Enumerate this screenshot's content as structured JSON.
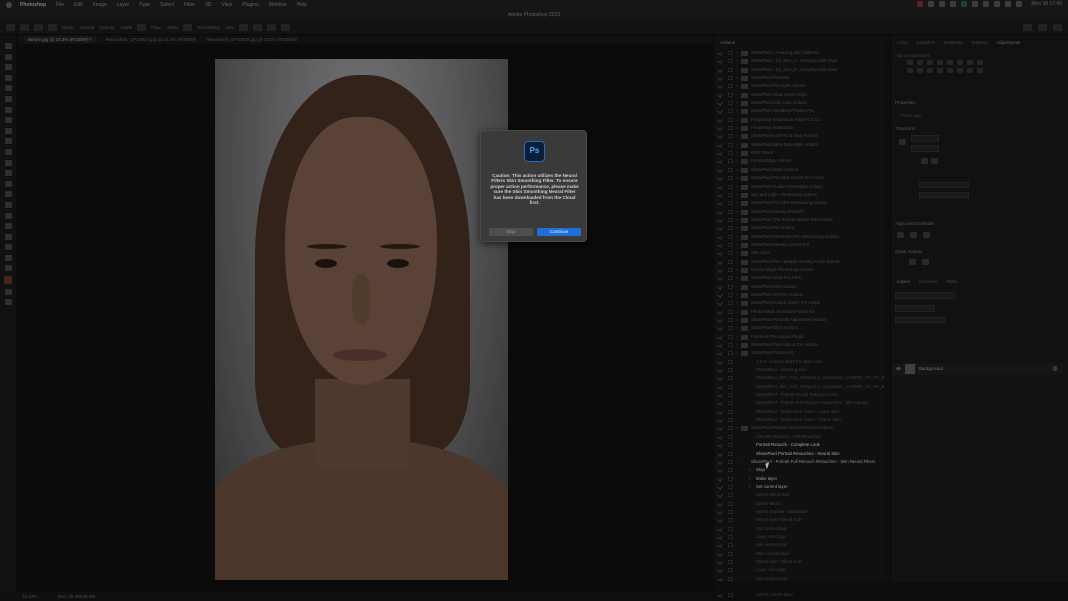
{
  "menubar": {
    "items": [
      "Photoshop",
      "File",
      "Edit",
      "Image",
      "Layer",
      "Type",
      "Select",
      "Filter",
      "3D",
      "View",
      "Plugins",
      "Window",
      "Help"
    ],
    "clock": "Mon 18 17:40"
  },
  "titlebar": {
    "title": "Adobe Photoshop 2023"
  },
  "optionsbar": {
    "labels": [
      "Mode:",
      "Normal",
      "Opacity:",
      "100%",
      "Flow:",
      "100%",
      "Smoothing:",
      "10%"
    ]
  },
  "tabs": [
    "Before.jpg @ 33.3% (RGB/8#) *",
    "Retouched_GP10837.jpg @ 33.3% (RGB/8#)",
    "Retouched_GP10838.jpg @ 33.3% (RGB/8#)"
  ],
  "dialog": {
    "logo_text": "Ps",
    "message": "Caution: This action utilizes the Neural Filters Skin Smoothing Filter. To ensure proper action performance, please make sure the Skin Smoothing Neural Filter has been downloaded from the Cloud first.",
    "cancel_label": "Stop",
    "continue_label": "Continue"
  },
  "actions": {
    "header": "Actions",
    "rows": [
      {
        "label": "SharePixel - Amazing Skin Softener",
        "type": "set"
      },
      {
        "label": "SharePixel - 1S_Skin_1 - Amazing Skin Glow",
        "type": "set"
      },
      {
        "label": "SharePixel - 1S_Skin_2 - Amazing Skin Glow",
        "type": "set"
      },
      {
        "label": "SharePixel Portraits",
        "type": "set"
      },
      {
        "label": "SharePixel Pro Light Actions",
        "type": "set"
      },
      {
        "label": "SharePixel Glow Action 2023",
        "type": "set"
      },
      {
        "label": "SharePixel Lab Color Actions",
        "type": "set"
      },
      {
        "label": "SharePixel Wedding Presets Pro",
        "type": "set"
      },
      {
        "label": "Frequency Separation Action CS CC",
        "type": "set"
      },
      {
        "label": "Frequency Separation",
        "type": "set"
      },
      {
        "label": "SharePixel LIGHTS & Dust Actions",
        "type": "set"
      },
      {
        "label": "SharePixel B&W Essentials Actions",
        "type": "set"
      },
      {
        "label": "HDR Tones",
        "type": "set"
      },
      {
        "label": "Portrait Edge Actions",
        "type": "set"
      },
      {
        "label": "SharePixel Base Actions",
        "type": "set"
      },
      {
        "label": "SharePixel Pro Skin Cream Pro Finish",
        "type": "set"
      },
      {
        "label": "SharePixel Golden Essentials Actions",
        "type": "set"
      },
      {
        "label": "Sun and Light - Photoshop Actions",
        "type": "set"
      },
      {
        "label": "SharePixel Pro Skin Retouching Actions",
        "type": "set"
      },
      {
        "label": "SharePixel Beauty Retouch",
        "type": "set"
      },
      {
        "label": "SharePixel The Portrait Master Pro Actions",
        "type": "set"
      },
      {
        "label": "SharePixel Pro Actions",
        "type": "set"
      },
      {
        "label": "SharePixel SmartSkin Pro Retouching Actions",
        "type": "set"
      },
      {
        "label": "SharePixel Beauty Actions Pro",
        "type": "set"
      },
      {
        "label": "Skin Care",
        "type": "set"
      },
      {
        "label": "SharePixel Pro - Beauty Healing Action Bundle",
        "type": "set"
      },
      {
        "label": "Glossy Magic Photoshop Actions",
        "type": "set"
      },
      {
        "label": "SharePixel Glow Pro Pack",
        "type": "set"
      },
      {
        "label": "SharePixel Skin Actions",
        "type": "set"
      },
      {
        "label": "SharePixel 30 Free Actions",
        "type": "set"
      },
      {
        "label": "SharePixel Actions 2023 - PS Action",
        "type": "set"
      },
      {
        "label": "Photo Magic 16 Instant Action Kit",
        "type": "set"
      },
      {
        "label": "SharePixel Portraits Adjustment Actions",
        "type": "set"
      },
      {
        "label": "SharePixel Glow Actions",
        "type": "set"
      },
      {
        "label": "Freedom Pro Actions Plugin",
        "type": "set"
      },
      {
        "label": "SharePixel Free Skin & Cm Actions",
        "type": "set"
      },
      {
        "label": "SharePixel Portrait Kit",
        "type": "set"
      },
      {
        "label": "1-2-3 - Actions 2023 PS 1994 Acts",
        "type": "cmd"
      },
      {
        "label": "SharePixel - Amazing Skin",
        "type": "cmd"
      },
      {
        "label": "SharePixel_Skin_FX1_Frequency_Separation_LAYERS_FE_GP_B",
        "type": "cmd"
      },
      {
        "label": "SharePixel_Skin_FX2_Frequency_Separation_LAYERS_FE_GP_B",
        "type": "cmd"
      },
      {
        "label": "SharePixel - Portrait Neural Retouch Action",
        "type": "cmd"
      },
      {
        "label": "SharePixel - Portrait Full Retouch Retouches - Skin Neural",
        "type": "cmd"
      },
      {
        "label": "SharePixel - Fresh Face Tones - Layer Skin",
        "type": "cmd"
      },
      {
        "label": "SharePixel - Fresh Face Tones - Frame Skin",
        "type": "cmd"
      },
      {
        "label": "SharePixel Portrait Neural Retouch Actions",
        "type": "set"
      },
      {
        "label": "Ultimate Retouch - Full Retouches",
        "type": "cmd"
      },
      {
        "label": "Portrait Retouch - Complete Look",
        "type": "cmd-hl"
      },
      {
        "label": "SharePixel Portrait Retouches - Neural Skin",
        "type": "cmd-hl"
      },
      {
        "label": "SharePixel - Portrait Full Retouch Retouches - Skin Neural Filters",
        "type": "open"
      },
      {
        "label": "Stop",
        "type": "step"
      },
      {
        "label": "Make layer",
        "type": "step"
      },
      {
        "label": "Set current layer",
        "type": "step"
      },
      {
        "label": "Select Blend Sub",
        "type": "sub"
      },
      {
        "label": "Delete Blend",
        "type": "sub"
      },
      {
        "label": "Select channel \"Saturation\"",
        "type": "sub"
      },
      {
        "label": "Select layer \"Blend Sub\"",
        "type": "sub"
      },
      {
        "label": "Set current layer",
        "type": "sub"
      },
      {
        "label": "Layer Via Copy",
        "type": "sub"
      },
      {
        "label": "Set current layer",
        "type": "sub"
      },
      {
        "label": "Hide current layer",
        "type": "sub"
      },
      {
        "label": "Select layer \"Blend Sub\"",
        "type": "sub"
      },
      {
        "label": "Layer Via Copy",
        "type": "sub"
      },
      {
        "label": "Set current layer",
        "type": "sub"
      },
      {
        "label": "Select layer \"Blend Sub\"",
        "type": "sub"
      },
      {
        "label": "Select current layer",
        "type": "sub"
      }
    ]
  },
  "properties": {
    "tabs": [
      "Color",
      "Swatches",
      "Gradients",
      "Patterns",
      "Adjustments"
    ],
    "adjustments_label": "Add an adjustment",
    "section": "Properties",
    "layer_kind": "Pixel Layer",
    "transform": "Transform",
    "align": "Align and Distribute",
    "quick_actions": "Quick Actions"
  },
  "layers": {
    "tabs": [
      "Layers",
      "Channels",
      "Paths"
    ],
    "layer_name": "Background"
  },
  "statusbar": {
    "zoom": "33.33%",
    "doc": "Doc: 36.0M/36.0M"
  }
}
